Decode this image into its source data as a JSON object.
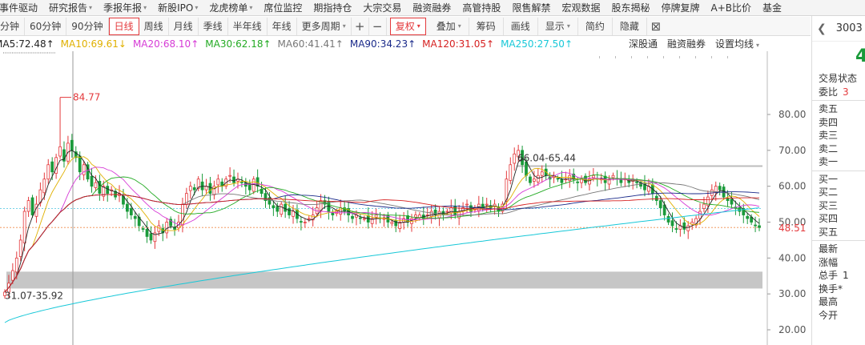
{
  "nav": [
    "事件驱动",
    "研究报告",
    "季报年报",
    "新股IPO",
    "龙虎榜单",
    "席位监控",
    "期指持仓",
    "大宗交易",
    "融资融券",
    "高管持股",
    "限售解禁",
    "宏观数据",
    "股东揭秘",
    "停牌复牌",
    "A+B比价",
    "基金"
  ],
  "toolbar": {
    "periods": [
      "分钟",
      "60分钟",
      "90分钟",
      "日线",
      "周线",
      "月线",
      "季线",
      "半年线",
      "年线",
      "更多周期"
    ],
    "active_period": "日线",
    "plus": "+",
    "minus": "−",
    "fuquan": "复权",
    "tools": [
      "叠加",
      "筹码",
      "画线",
      "显示",
      "简约",
      "隐藏"
    ],
    "close": "⊠"
  },
  "ma": [
    {
      "label": "MA5:72.48",
      "color": "#222222"
    },
    {
      "label": "MA10:69.61",
      "color": "#e0b000"
    },
    {
      "label": "MA20:68.10",
      "color": "#d63bd6"
    },
    {
      "label": "MA30:62.18",
      "color": "#22aa22"
    },
    {
      "label": "MA60:41.41",
      "color": "#777777"
    },
    {
      "label": "MA90:34.23",
      "color": "#1a2a8a"
    },
    {
      "label": "MA120:31.05",
      "color": "#d62020"
    },
    {
      "label": "MA250:27.50",
      "color": "#18c8d8"
    }
  ],
  "chart_links": [
    "深股通",
    "融资融券",
    "设置均线"
  ],
  "chart": {
    "yticks": [
      "80.00",
      "70.00",
      "60.00",
      "50.00",
      "40.00",
      "30.00",
      "20.00"
    ],
    "current_price": "48.51",
    "annotations": {
      "high": "84.77",
      "range_top": "66.04-65.44",
      "range_bottom": "31.07-35.92"
    }
  },
  "chart_data": {
    "type": "candlestick",
    "ylim": [
      17,
      87
    ],
    "current_price": 48.51,
    "close": [
      30.5,
      33,
      36.5,
      40,
      45,
      53,
      56,
      52,
      55,
      59,
      62,
      66,
      64,
      68,
      71,
      67,
      72,
      70,
      68,
      64,
      66,
      62,
      60,
      61,
      58,
      60,
      58,
      59,
      57,
      58,
      55,
      53,
      52,
      51,
      49,
      48,
      46,
      45,
      47,
      49,
      47,
      50,
      49,
      48,
      50,
      55,
      58,
      60,
      59,
      62,
      59,
      60,
      58,
      60,
      62,
      60,
      62,
      63,
      61,
      62,
      61,
      60,
      59,
      62,
      60,
      58,
      56,
      55,
      54,
      53,
      55,
      53,
      52,
      53,
      51,
      50,
      50,
      51,
      52,
      54,
      56,
      55,
      53,
      52,
      53,
      54,
      53,
      52,
      51,
      52,
      51,
      51,
      50,
      51,
      52,
      51,
      51,
      50,
      50,
      49,
      50,
      51,
      50,
      51,
      52,
      52,
      51,
      52,
      53,
      52,
      53,
      52,
      53,
      54,
      52,
      53,
      54,
      55,
      53,
      54,
      55,
      54,
      55,
      54,
      55,
      53,
      55,
      62,
      66,
      69,
      70,
      66,
      63,
      61,
      62,
      63,
      64,
      63,
      62,
      63,
      62,
      61,
      62,
      63,
      62,
      61,
      62,
      61,
      62,
      63,
      62,
      62,
      61,
      62,
      63,
      62,
      61,
      62,
      61,
      62,
      61,
      60,
      59,
      60,
      58,
      56,
      54,
      52,
      50,
      49,
      48,
      49,
      48,
      49,
      50,
      51,
      53,
      55,
      57,
      59,
      60,
      59,
      57,
      56,
      55,
      54,
      53,
      52,
      51,
      50,
      49,
      48.5
    ]
  },
  "right_panel": {
    "code": "3003",
    "price": "4",
    "rows_top": [
      {
        "label": "交易状态",
        "val": ""
      },
      {
        "label": "委比",
        "val": "3"
      }
    ],
    "sell": [
      "卖五",
      "卖四",
      "卖三",
      "卖二",
      "卖一"
    ],
    "buy": [
      "买一",
      "买二",
      "买三",
      "买四",
      "买五"
    ],
    "rows_bottom": [
      {
        "label": "最新",
        "val": ""
      },
      {
        "label": "涨幅",
        "val": ""
      },
      {
        "label": "总手",
        "val": "1"
      },
      {
        "label": "换手*",
        "val": ""
      },
      {
        "label": "最高",
        "val": ""
      },
      {
        "label": "今开",
        "val": ""
      }
    ]
  }
}
